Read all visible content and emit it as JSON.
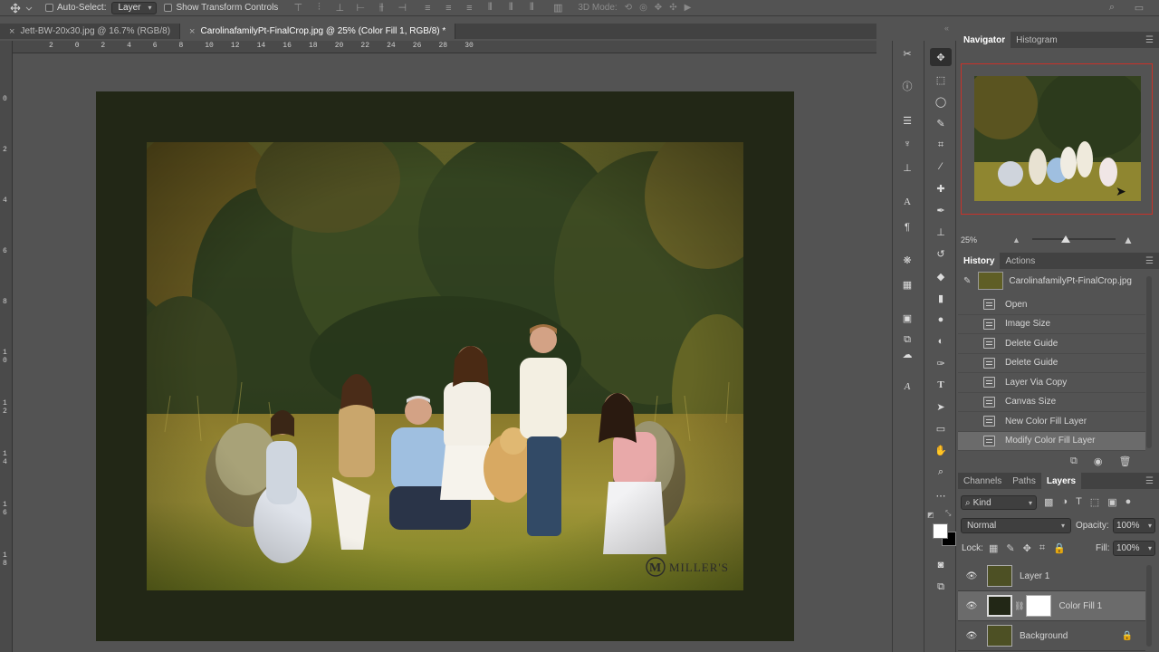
{
  "options_bar": {
    "auto_select_label": "Auto-Select:",
    "auto_select_value": "Layer",
    "show_transform_label": "Show Transform Controls",
    "three_d_mode_label": "3D Mode:"
  },
  "doc_tabs": [
    {
      "title": "Jett-BW-20x30.jpg @ 16.7% (RGB/8)",
      "active": false
    },
    {
      "title": "CarolinafamilyPt-FinalCrop.jpg @ 25% (Color Fill 1, RGB/8) *",
      "active": true
    }
  ],
  "ruler": {
    "h_labels": [
      "2",
      "0",
      "2",
      "4",
      "6",
      "8",
      "10",
      "12",
      "14",
      "16",
      "18",
      "20",
      "22",
      "24",
      "26",
      "28",
      "30"
    ],
    "v_labels": [
      "0",
      "2",
      "4",
      "6",
      "8",
      "1\n0",
      "1\n2",
      "1\n4",
      "1\n6",
      "1\n8"
    ]
  },
  "watermark": "MILLER'S",
  "navigator": {
    "tabs": [
      "Navigator",
      "Histogram"
    ],
    "zoom": "25%",
    "zoom_slider_fraction": 0.4
  },
  "history": {
    "tabs": [
      "History",
      "Actions"
    ],
    "snapshot_label": "CarolinafamilyPt-FinalCrop.jpg",
    "items": [
      "Open",
      "Image Size",
      "Delete Guide",
      "Delete Guide",
      "Layer Via Copy",
      "Canvas Size",
      "New Color Fill Layer",
      "Modify Color Fill Layer"
    ],
    "active_index": 7
  },
  "layers_panel": {
    "tabs": [
      "Channels",
      "Paths",
      "Layers"
    ],
    "filter_label": "Kind",
    "blend_mode": "Normal",
    "opacity_label": "Opacity:",
    "opacity_value": "100%",
    "lock_label": "Lock:",
    "fill_label": "Fill:",
    "fill_value": "100%",
    "layers": [
      {
        "name": "Layer 1",
        "active": false
      },
      {
        "name": "Color Fill 1",
        "active": true
      },
      {
        "name": "Background",
        "active": false,
        "locked": true
      }
    ]
  },
  "colors": {
    "canvas_fill": "#222716",
    "nav_frame": "#c8322a"
  }
}
